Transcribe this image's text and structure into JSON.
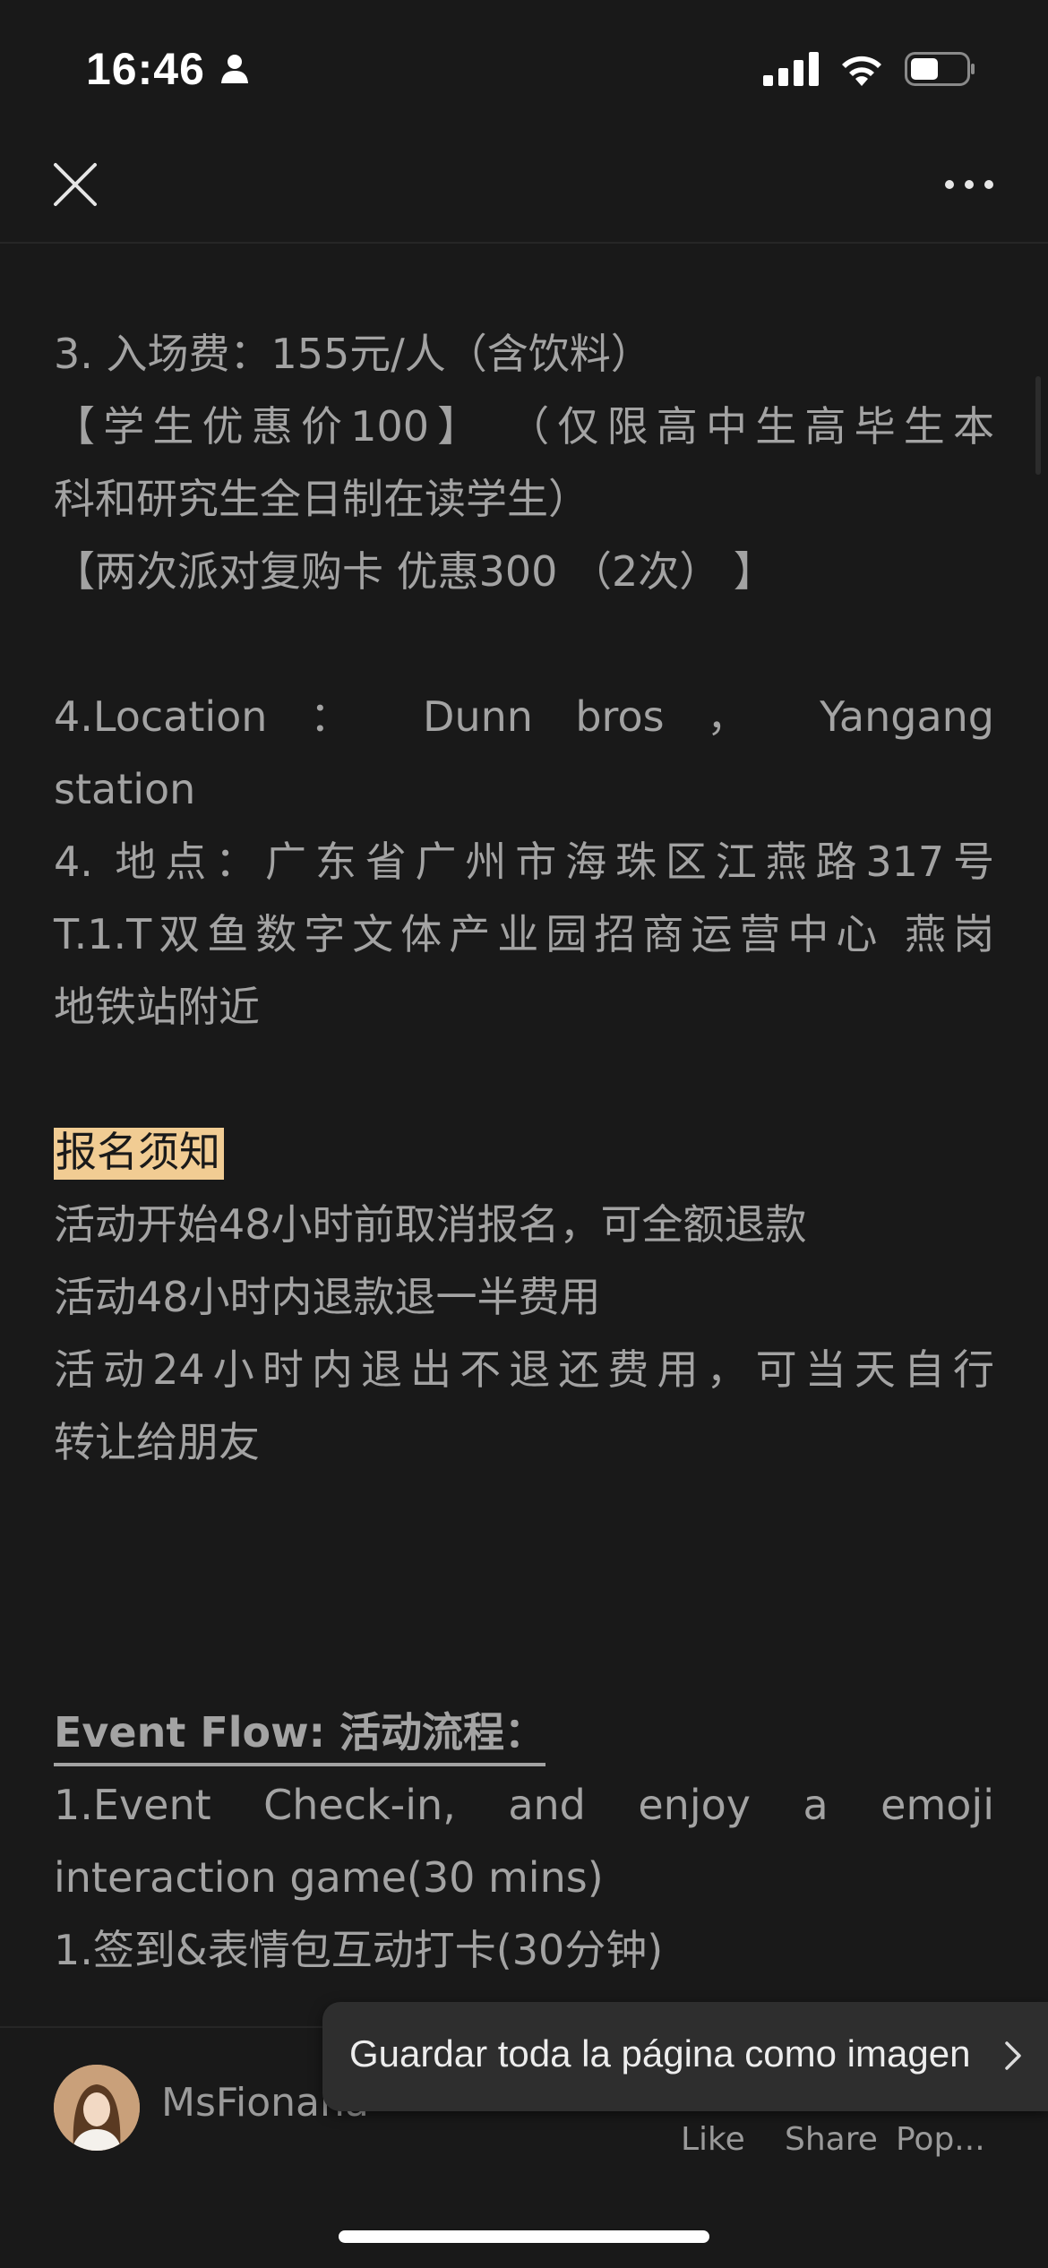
{
  "status_bar": {
    "time": "16:46",
    "icons": [
      "person-icon",
      "signal-icon",
      "wifi-icon",
      "battery-icon"
    ]
  },
  "nav": {
    "close_icon": "close-icon",
    "more_icon": "more-icon"
  },
  "article": {
    "lines": [
      "3. 入场费：155元/人（含饮料）",
      "【学生优惠价100】  （仅限高中生高毕生本",
      "科和研究生全日制在读学生）",
      "【两次派对复购卡 优惠300 （2次） 】",
      "",
      "4.Location ： Dunn bros ， Yangang",
      "station",
      "4. 地点：广东省广州市海珠区江燕路317号",
      "T.1.T双鱼数字文体产业园招商运营中心 燕岗",
      "地铁站附近",
      "",
      "报名须知",
      "活动开始48小时前取消报名，可全额退款",
      "活动48小时内退款退一半费用",
      "活动24小时内退出不退还费用，可当天自行",
      "转让给朋友",
      "",
      "",
      "",
      "Event Flow: 活动流程：",
      "1.Event Check-in, and enjoy a emoji",
      "interaction game(30 mins)",
      "1.签到&表情包互动打卡(30分钟)"
    ]
  },
  "bottom_bar": {
    "author": "MsFionana",
    "like": "Like",
    "share": "Share",
    "pop": "Pop..."
  },
  "toast": {
    "text": "Guardar toda la página como imagen",
    "icon": "chevron-right-icon"
  },
  "colors": {
    "background": "#191919",
    "text": "#a3a3a3",
    "highlight": "#f1cc93"
  }
}
